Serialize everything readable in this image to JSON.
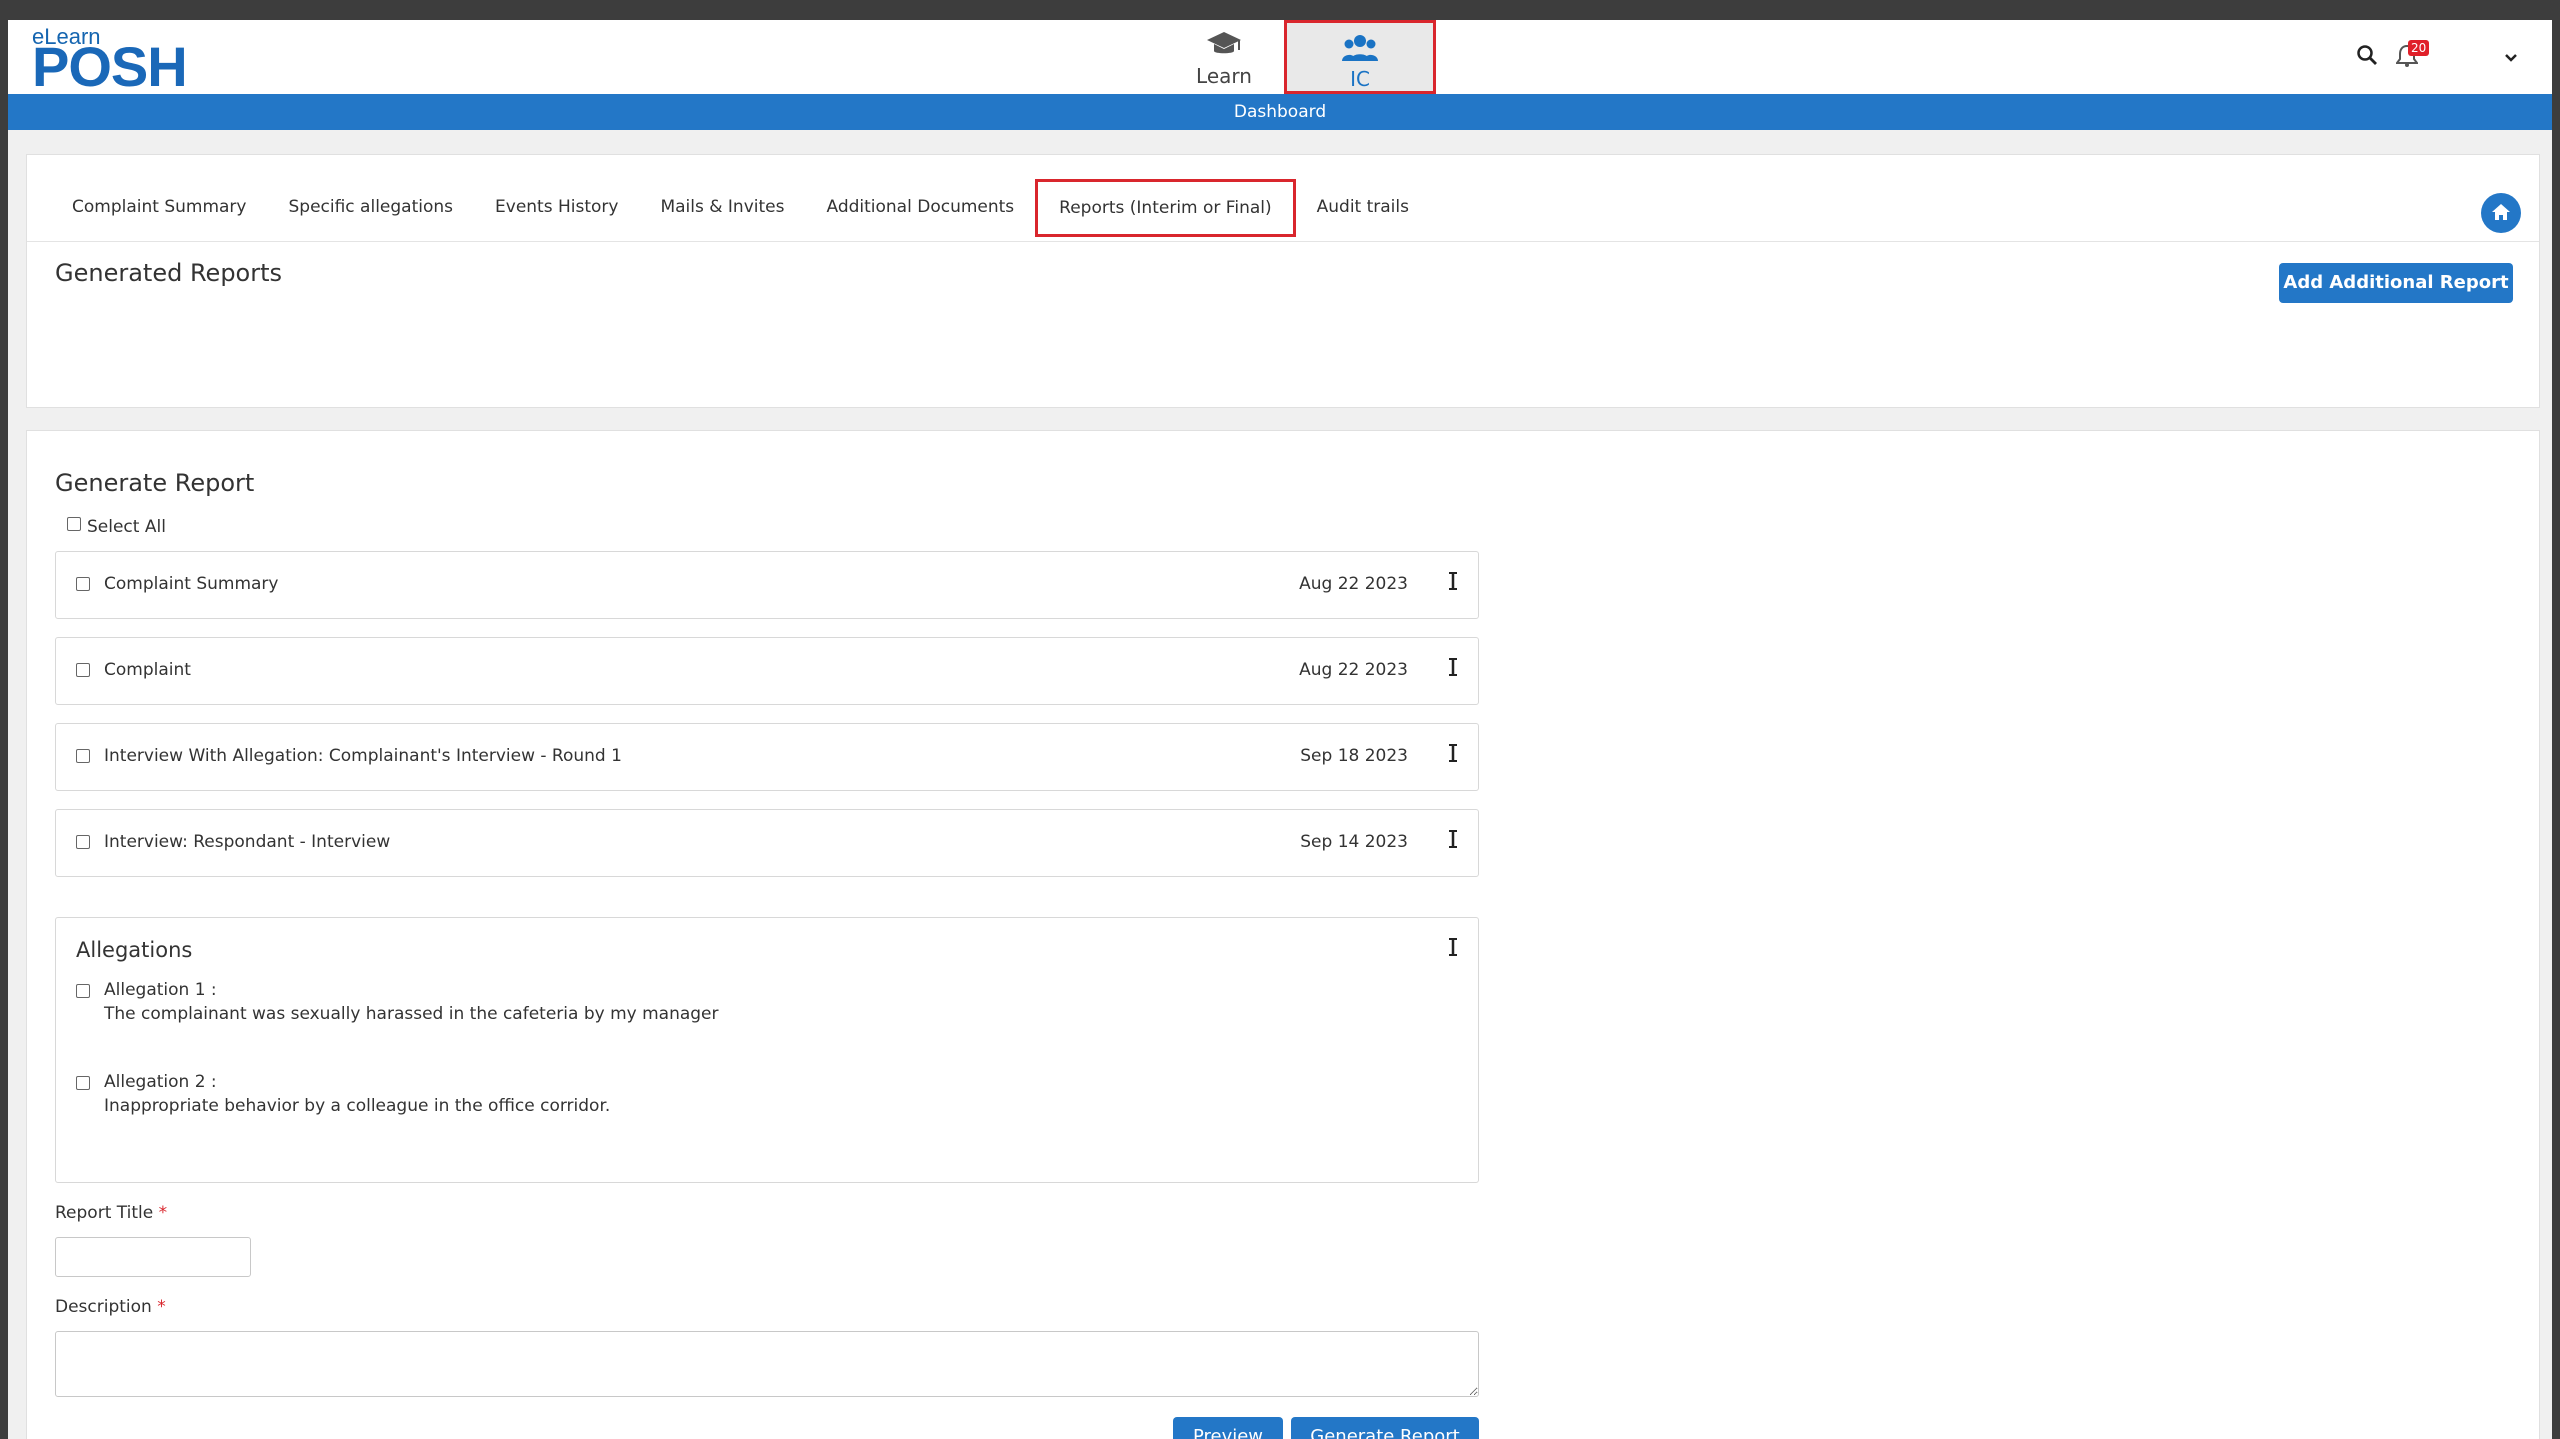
{
  "brand": {
    "top": "eLearn",
    "main": "POSH"
  },
  "nav": [
    {
      "label": "Learn",
      "icon": "graduation-cap-icon"
    },
    {
      "label": "IC",
      "icon": "users-icon"
    }
  ],
  "header": {
    "notification_count": "20"
  },
  "dashboard_label": "Dashboard",
  "tabs": [
    "Complaint Summary",
    "Specific allegations",
    "Events History",
    "Mails & Invites",
    "Additional Documents",
    "Reports (Interim or Final)",
    "Audit trails"
  ],
  "active_tab": "Reports (Interim or Final)",
  "generated_reports": {
    "title": "Generated Reports",
    "add_button": "Add Additional Report"
  },
  "generate_report": {
    "title": "Generate Report",
    "select_all": "Select All",
    "items": [
      {
        "label": "Complaint Summary",
        "date": "Aug 22 2023"
      },
      {
        "label": "Complaint",
        "date": "Aug 22 2023"
      },
      {
        "label": "Interview With Allegation: Complainant's Interview - Round 1",
        "date": "Sep 18 2023"
      },
      {
        "label": "Interview: Respondant - Interview",
        "date": "Sep 14 2023"
      }
    ],
    "allegations": {
      "title": "Allegations",
      "items": [
        {
          "name": "Allegation 1 :",
          "text": "The complainant was sexually harassed in the cafeteria by my manager"
        },
        {
          "name": "Allegation 2 :",
          "text": "Inappropriate behavior by a colleague in the office corridor."
        }
      ]
    },
    "report_title_label": "Report Title",
    "report_title_value": "",
    "description_label": "Description",
    "description_value": "",
    "required_mark": "*",
    "preview_button": "Preview",
    "generate_button": "Generate Report"
  },
  "colors": {
    "primary": "#2377c7",
    "highlight": "#d9262d",
    "badge": "#e0202a"
  }
}
